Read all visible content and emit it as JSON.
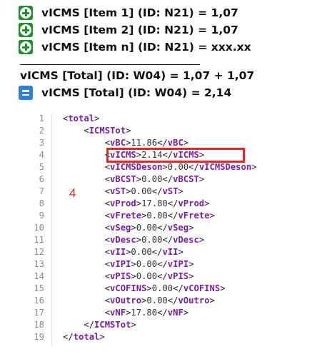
{
  "summary": [
    {
      "icon": "plus-icon",
      "text": "vICMS [Item 1] (ID: N21) = 1,07"
    },
    {
      "icon": "plus-icon",
      "text": "vICMS [Item 2] (ID: N21) = 1,07"
    },
    {
      "icon": "plus-icon",
      "text": "vICMS [Item n] (ID: N21) = xxx.xx"
    }
  ],
  "total_formula": "vICMS [Total] (ID: W04) = 1,07 + 1,07",
  "result": {
    "icon": "equals-icon",
    "text": "vICMS [Total] (ID: W04) = 2,14"
  },
  "annotation": "4",
  "code_lines": [
    {
      "n": "1",
      "indent": 0,
      "open": "total"
    },
    {
      "n": "2",
      "indent": 1,
      "open": "ICMSTot"
    },
    {
      "n": "3",
      "indent": 2,
      "open": "vBC",
      "value": "11.86"
    },
    {
      "n": "4",
      "indent": 2,
      "open": "vICMS",
      "value": "2.14"
    },
    {
      "n": "5",
      "indent": 2,
      "open": "vICMSDeson",
      "value": "0.00"
    },
    {
      "n": "6",
      "indent": 2,
      "open": "vBCST",
      "value": "0.00"
    },
    {
      "n": "7",
      "indent": 2,
      "open": "vST",
      "value": "0.00"
    },
    {
      "n": "8",
      "indent": 2,
      "open": "vProd",
      "value": "17.80"
    },
    {
      "n": "9",
      "indent": 2,
      "open": "vFrete",
      "value": "0.00"
    },
    {
      "n": "10",
      "indent": 2,
      "open": "vSeg",
      "value": "0.00"
    },
    {
      "n": "11",
      "indent": 2,
      "open": "vDesc",
      "value": "0.00"
    },
    {
      "n": "12",
      "indent": 2,
      "open": "vII",
      "value": "0.00"
    },
    {
      "n": "13",
      "indent": 2,
      "open": "vIPI",
      "value": "0.00"
    },
    {
      "n": "14",
      "indent": 2,
      "open": "vPIS",
      "value": "0.00"
    },
    {
      "n": "15",
      "indent": 2,
      "open": "vCOFINS",
      "value": "0.00"
    },
    {
      "n": "16",
      "indent": 2,
      "open": "vOutro",
      "value": "0.00"
    },
    {
      "n": "17",
      "indent": 2,
      "open": "vNF",
      "value": "17.80"
    },
    {
      "n": "18",
      "indent": 1,
      "close": "ICMSTot"
    },
    {
      "n": "19",
      "indent": 0,
      "close": "total"
    }
  ],
  "highlighted_line": "4",
  "colors": {
    "plus": "#1f8f2c",
    "equals": "#2f7fd6",
    "tag": "#7a1fa2",
    "highlight": "#e32626"
  }
}
